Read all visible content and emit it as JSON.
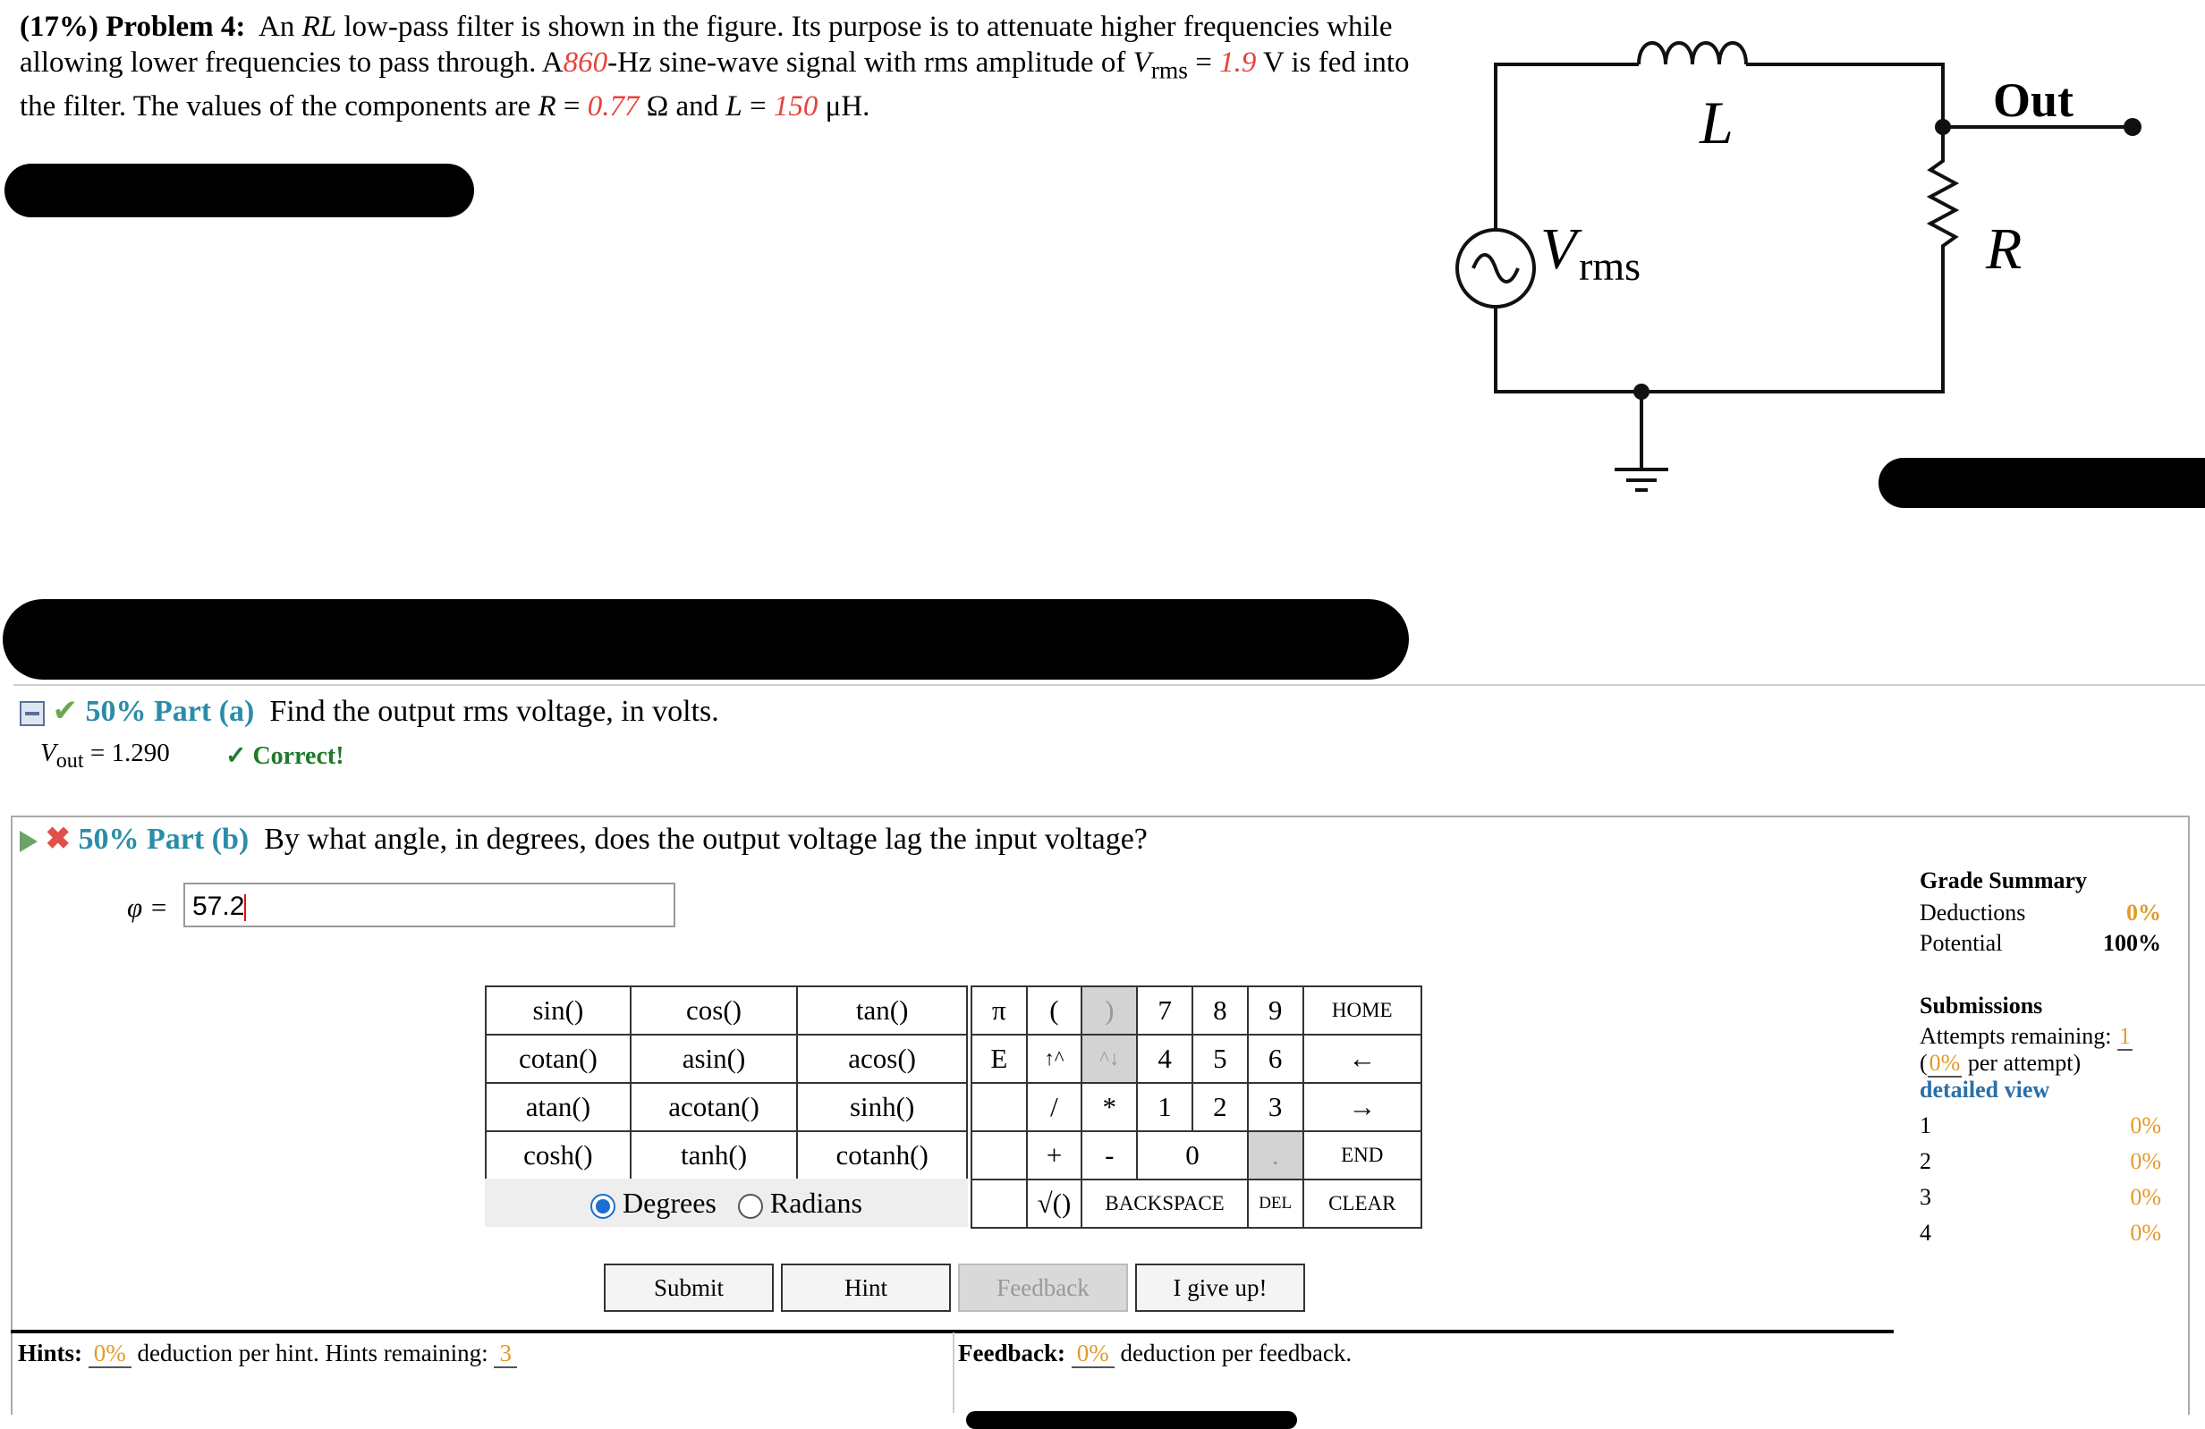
{
  "problem": {
    "weight": "(17%)",
    "title": "Problem 4:",
    "t1": "An",
    "rl": "RL",
    "t2": "low-pass filter is shown in the figure. Its purpose is to attenuate higher frequencies while allowing lower frequencies to pass through. A",
    "freq": "860",
    "t3": "-Hz sine-wave signal with rms amplitude of",
    "v": "V",
    "rms_sub": "rms",
    "eq": "=",
    "vrms_value": "1.9",
    "t4": "V is fed into the filter. The values of the components are",
    "r": "R",
    "r_value": "0.77",
    "t5": "Ω and",
    "l": "L",
    "l_value": "150",
    "t6": "μH."
  },
  "circuit": {
    "inductor_label": "L",
    "out_label": "Out",
    "source_label_v": "V",
    "source_label_sub": "rms",
    "resistor_label": "R"
  },
  "part_a": {
    "weight": "50% Part (a)",
    "question": "Find the output rms voltage, in volts.",
    "answer_var": "V",
    "answer_sub": "out",
    "answer_text": "= 1.290",
    "correct": "✓ Correct!"
  },
  "part_b": {
    "weight": "50% Part (b)",
    "question": "By what angle, in degrees, does the output voltage lag the input voltage?",
    "var_label": "φ =",
    "input_value": "57.2"
  },
  "keypad": {
    "functions": [
      [
        "sin()",
        "cos()",
        "tan()"
      ],
      [
        "cotan()",
        "asin()",
        "acos()"
      ],
      [
        "atan()",
        "acotan()",
        "sinh()"
      ],
      [
        "cosh()",
        "tanh()",
        "cotanh()"
      ]
    ],
    "degrees": "Degrees",
    "radians": "Radians",
    "keys": {
      "pi": "π",
      "lparen": "(",
      "rparen": ")",
      "k7": "7",
      "k8": "8",
      "k9": "9",
      "home": "HOME",
      "e": "E",
      "up": "↑^",
      "down": "^↓",
      "k4": "4",
      "k5": "5",
      "k6": "6",
      "left": "←",
      "div": "/",
      "mul": "*",
      "k1": "1",
      "k2": "2",
      "k3": "3",
      "right": "→",
      "plus": "+",
      "minus": "-",
      "k0": "0",
      "dot": ".",
      "end": "END",
      "sqrt": "√()",
      "backspace": "BACKSPACE",
      "del": "DEL",
      "clear": "CLEAR"
    }
  },
  "buttons": {
    "submit": "Submit",
    "hint": "Hint",
    "feedback": "Feedback",
    "give_up": "I give up!"
  },
  "hints_bar": {
    "label": "Hints:",
    "pct": "0%",
    "text": "deduction per hint. Hints remaining:",
    "remaining": "3"
  },
  "feedback_bar": {
    "label": "Feedback:",
    "pct": "0%",
    "text": "deduction per feedback."
  },
  "grade_summary": {
    "title": "Grade Summary",
    "deductions_label": "Deductions",
    "deductions_value": "0%",
    "potential_label": "Potential",
    "potential_value": "100%"
  },
  "submissions": {
    "title": "Submissions",
    "attempts_label": "Attempts remaining:",
    "attempts_value": "1",
    "per_attempt_pct": "0%",
    "per_attempt_text": "per attempt)",
    "open_paren": "(",
    "detailed_view": "detailed view",
    "rows": [
      {
        "n": "1",
        "pct": "0%"
      },
      {
        "n": "2",
        "pct": "0%"
      },
      {
        "n": "3",
        "pct": "0%"
      },
      {
        "n": "4",
        "pct": "0%"
      }
    ]
  }
}
